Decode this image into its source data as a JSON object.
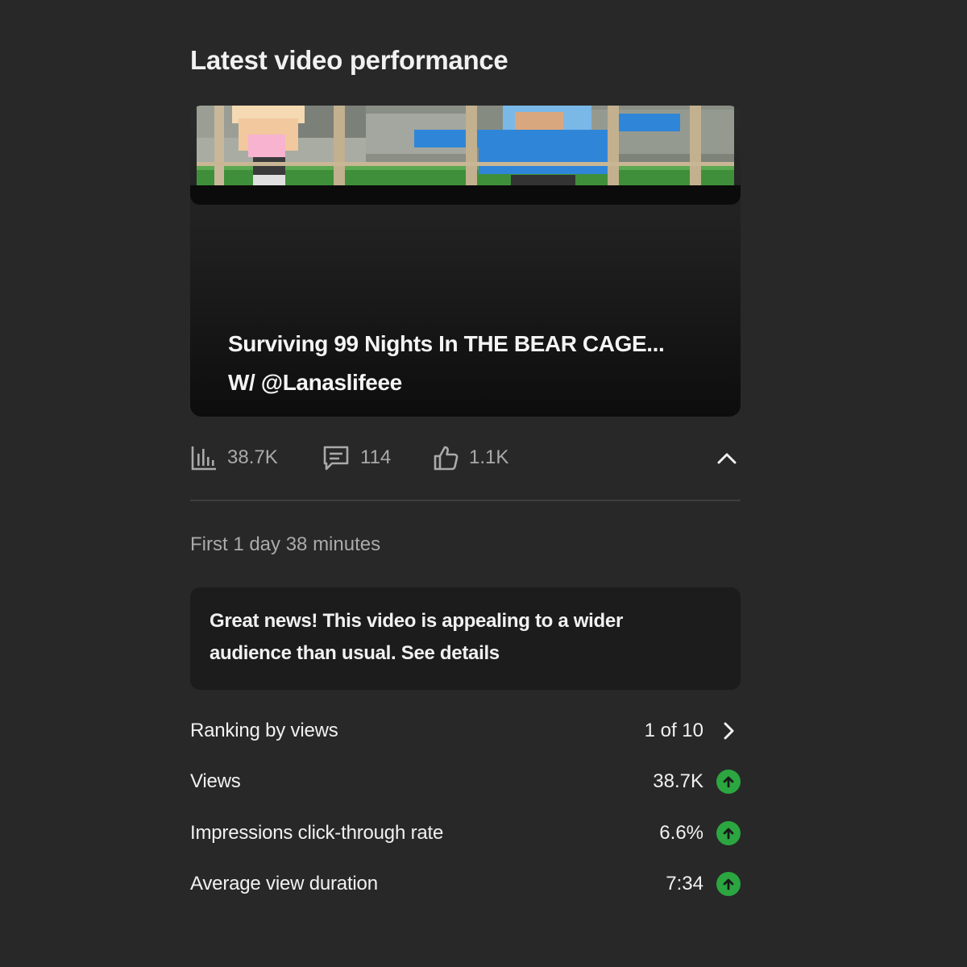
{
  "section_title": "Latest video performance",
  "video": {
    "title_line1": "Surviving 99 Nights In THE BEAR CAGE...",
    "title_line2": "W/ @Lanaslifeee"
  },
  "stats": {
    "views": "38.7K",
    "comments": "114",
    "likes": "1.1K"
  },
  "period": "First 1 day 38 minutes",
  "notice": "Great news! This video is appealing to a wider audience than usual. See details",
  "metrics": {
    "ranking": {
      "label": "Ranking by views",
      "value": "1 of 10",
      "icon": "chevron-right-icon"
    },
    "views": {
      "label": "Views",
      "value": "38.7K",
      "icon": "arrow-up-icon"
    },
    "ctr": {
      "label": "Impressions click-through rate",
      "value": "6.6%",
      "icon": "arrow-up-icon"
    },
    "avd": {
      "label": "Average view duration",
      "value": "7:34",
      "icon": "arrow-up-icon"
    }
  },
  "colors": {
    "background": "#282828",
    "card": "#1c1c1c",
    "up_indicator": "#2ba640",
    "muted_text": "#aaaaaa"
  }
}
